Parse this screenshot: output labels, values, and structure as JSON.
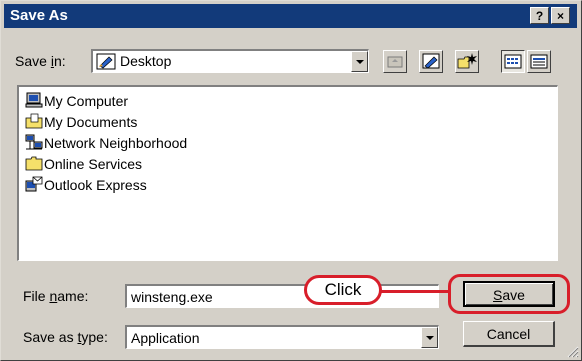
{
  "titlebar": {
    "title": "Save As",
    "help": "?",
    "close": "×"
  },
  "save_in": {
    "label_prefix": "Save ",
    "label_underlined": "i",
    "label_suffix": "n:",
    "value": "Desktop"
  },
  "toolbar": {
    "icons": [
      "up-one-level-icon",
      "desktop-icon",
      "new-folder-icon",
      "list-view-icon",
      "details-view-icon"
    ]
  },
  "file_list": {
    "items": [
      {
        "label": "My Computer",
        "icon": "computer-icon"
      },
      {
        "label": "My Documents",
        "icon": "documents-folder-icon"
      },
      {
        "label": "Network Neighborhood",
        "icon": "network-icon"
      },
      {
        "label": "Online Services",
        "icon": "folder-icon"
      },
      {
        "label": "Outlook Express",
        "icon": "outlook-icon"
      }
    ]
  },
  "file_name": {
    "label_prefix": "File ",
    "label_underlined": "n",
    "label_suffix": "ame:",
    "value": "winsteng.exe"
  },
  "save_as_type": {
    "label_prefix": "Save as ",
    "label_underlined": "t",
    "label_suffix": "ype:",
    "value": "Application"
  },
  "buttons": {
    "save_underlined": "S",
    "save_rest": "ave",
    "cancel": "Cancel"
  },
  "annotation": {
    "callout_text": "Click",
    "color": "#d81e2a"
  },
  "colors": {
    "titlebar": "#123a7a",
    "face": "#d4d0c8",
    "folder": "#f5e06a"
  }
}
